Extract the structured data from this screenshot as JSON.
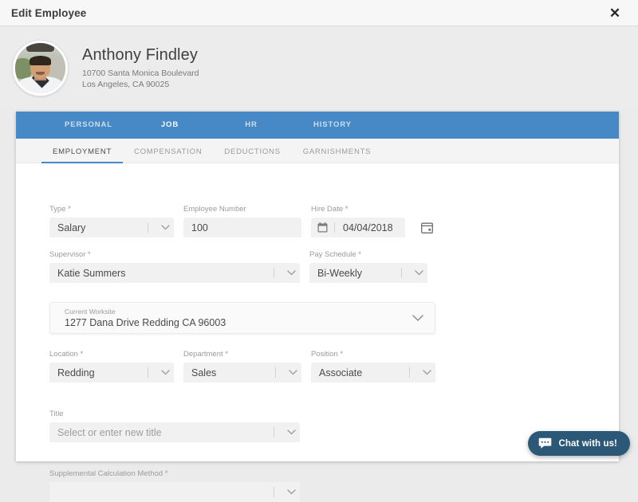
{
  "window": {
    "title": "Edit Employee",
    "close_label": "✕"
  },
  "employee": {
    "name": "Anthony Findley",
    "address_line1": "10700 Santa Monica Boulevard",
    "address_line2": "Los Angeles, CA 90025",
    "avatar_alt": "employee-photo"
  },
  "tabs": {
    "items": [
      {
        "label": "PERSONAL",
        "active": false
      },
      {
        "label": "JOB",
        "active": true
      },
      {
        "label": "HR",
        "active": false
      },
      {
        "label": "HISTORY",
        "active": false
      }
    ]
  },
  "subtabs": {
    "items": [
      {
        "label": "EMPLOYMENT",
        "active": true
      },
      {
        "label": "COMPENSATION",
        "active": false
      },
      {
        "label": "DEDUCTIONS",
        "active": false
      },
      {
        "label": "GARNISHMENTS",
        "active": false
      }
    ]
  },
  "form": {
    "type": {
      "label": "Type *",
      "value": "Salary"
    },
    "employee_number": {
      "label": "Employee Number",
      "value": "100"
    },
    "hire_date": {
      "label": "Hire Date *",
      "value": "04/04/2018"
    },
    "supervisor": {
      "label": "Supervisor *",
      "value": "Katie Summers"
    },
    "pay_schedule": {
      "label": "Pay Schedule *",
      "value": "Bi-Weekly"
    },
    "current_worksite": {
      "label": "Current Worksite",
      "value": "1277 Dana Drive Redding CA 96003"
    },
    "location": {
      "label": "Location *",
      "value": "Redding"
    },
    "department": {
      "label": "Department *",
      "value": "Sales"
    },
    "position": {
      "label": "Position *",
      "value": "Associate"
    },
    "title": {
      "label": "Title",
      "placeholder": "Select or enter new title"
    },
    "supplemental_calculation_method": {
      "label": "Supplemental Calculation Method *"
    }
  },
  "chat": {
    "label": "Chat with us!"
  },
  "colors": {
    "accent_blue": "#4788c7",
    "chat_navy": "#2b5876",
    "page_bg": "#ebebeb",
    "field_bg": "#f1f1f1"
  }
}
